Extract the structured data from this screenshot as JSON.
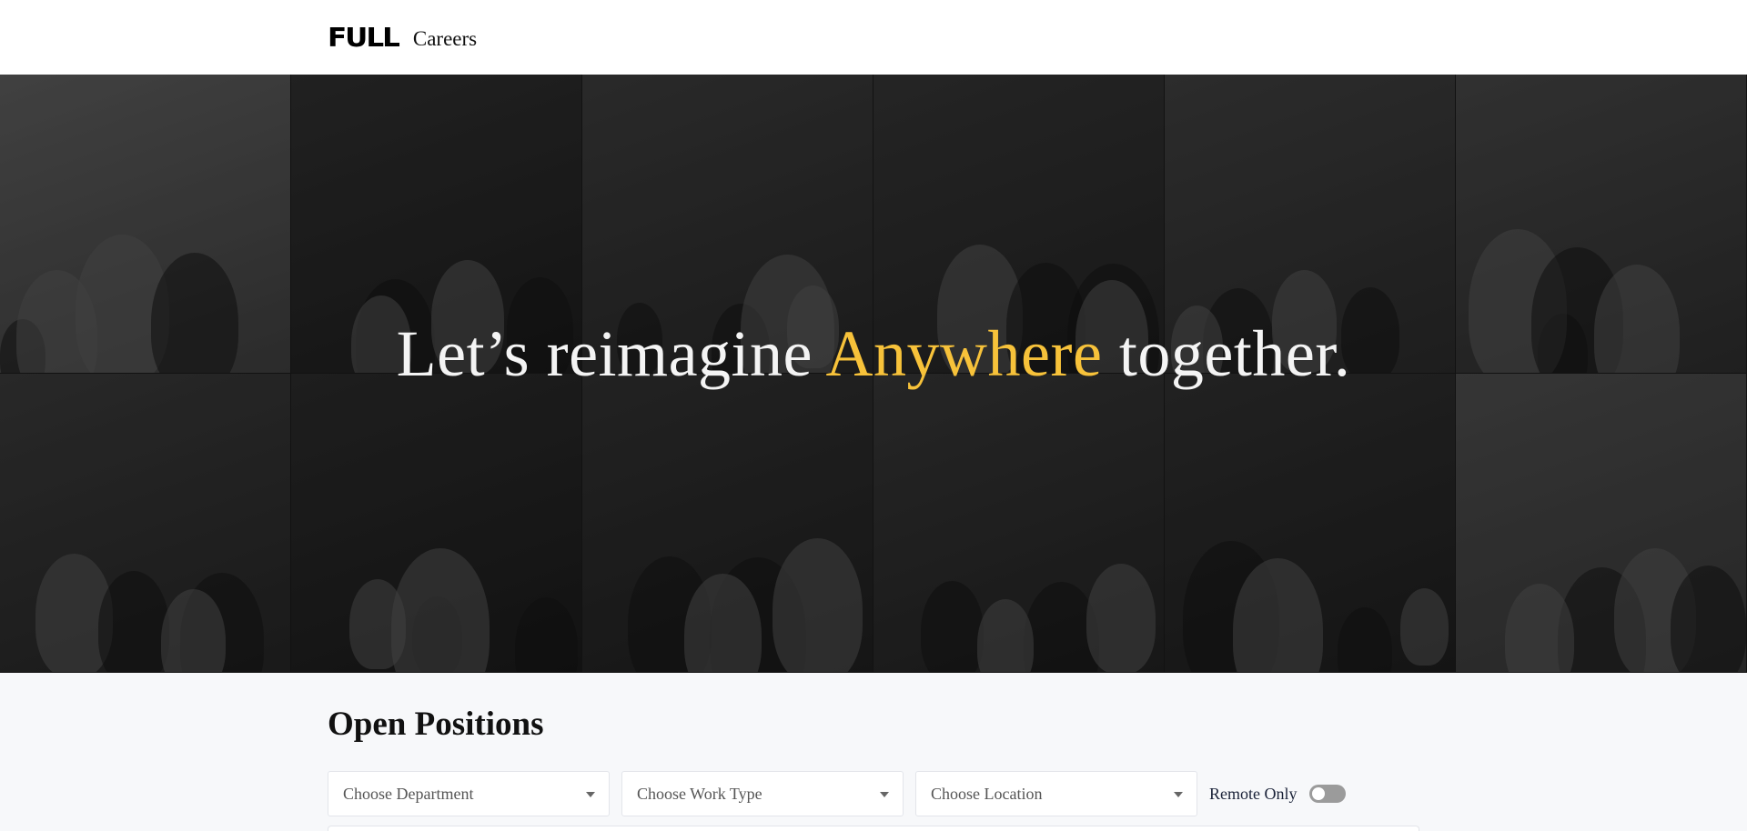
{
  "header": {
    "logo_text": "FULL",
    "section_label": "Careers"
  },
  "hero": {
    "headline_before": "Let’s reimagine ",
    "headline_accent": "Anywhere",
    "headline_after": " together.",
    "accent_color": "#f7c23a"
  },
  "positions": {
    "title": "Open Positions",
    "filters": {
      "department_placeholder": "Choose Department",
      "work_type_placeholder": "Choose Work Type",
      "location_placeholder": "Choose Location",
      "remote_label": "Remote Only",
      "remote_on": false
    }
  }
}
